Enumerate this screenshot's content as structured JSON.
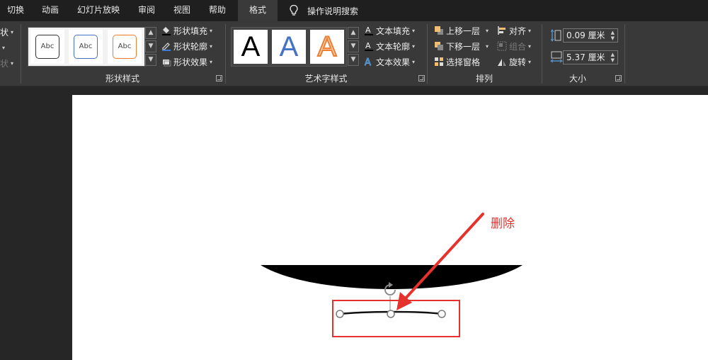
{
  "tabs": [
    {
      "label": "切换",
      "active": false
    },
    {
      "label": "动画",
      "active": false
    },
    {
      "label": "幻灯片放映",
      "active": false
    },
    {
      "label": "审阅",
      "active": false
    },
    {
      "label": "视图",
      "active": false
    },
    {
      "label": "帮助",
      "active": false
    },
    {
      "label": "格式",
      "active": true
    }
  ],
  "tell_me": "操作说明搜索",
  "left_cut": {
    "item1": "状",
    "item2": "状"
  },
  "shape_styles": {
    "label": "形状样式",
    "preset_text": "Abc",
    "presets": [
      {
        "border": "#333333"
      },
      {
        "border": "#4472c4"
      },
      {
        "border": "#ed7d31"
      }
    ],
    "fill": "形状填充",
    "outline": "形状轮廓",
    "effects": "形状效果"
  },
  "wordart_styles": {
    "label": "艺术字样式",
    "preset_letter": "A",
    "text_fill": "文本填充",
    "text_outline": "文本轮廓",
    "text_effects": "文本效果"
  },
  "arrange": {
    "label": "排列",
    "bring_forward": "上移一层",
    "send_backward": "下移一层",
    "selection_pane": "选择窗格",
    "align": "对齐",
    "group": "组合",
    "rotate": "旋转"
  },
  "size": {
    "label": "大小",
    "height": "0.09 厘米",
    "width": "5.37 厘米"
  },
  "annotation": {
    "label": "删除",
    "color": "#e5322d"
  },
  "colors": {
    "accent_red": "#e5322d",
    "ribbon_bg": "#393939",
    "tab_bg": "#1f1f1f"
  }
}
